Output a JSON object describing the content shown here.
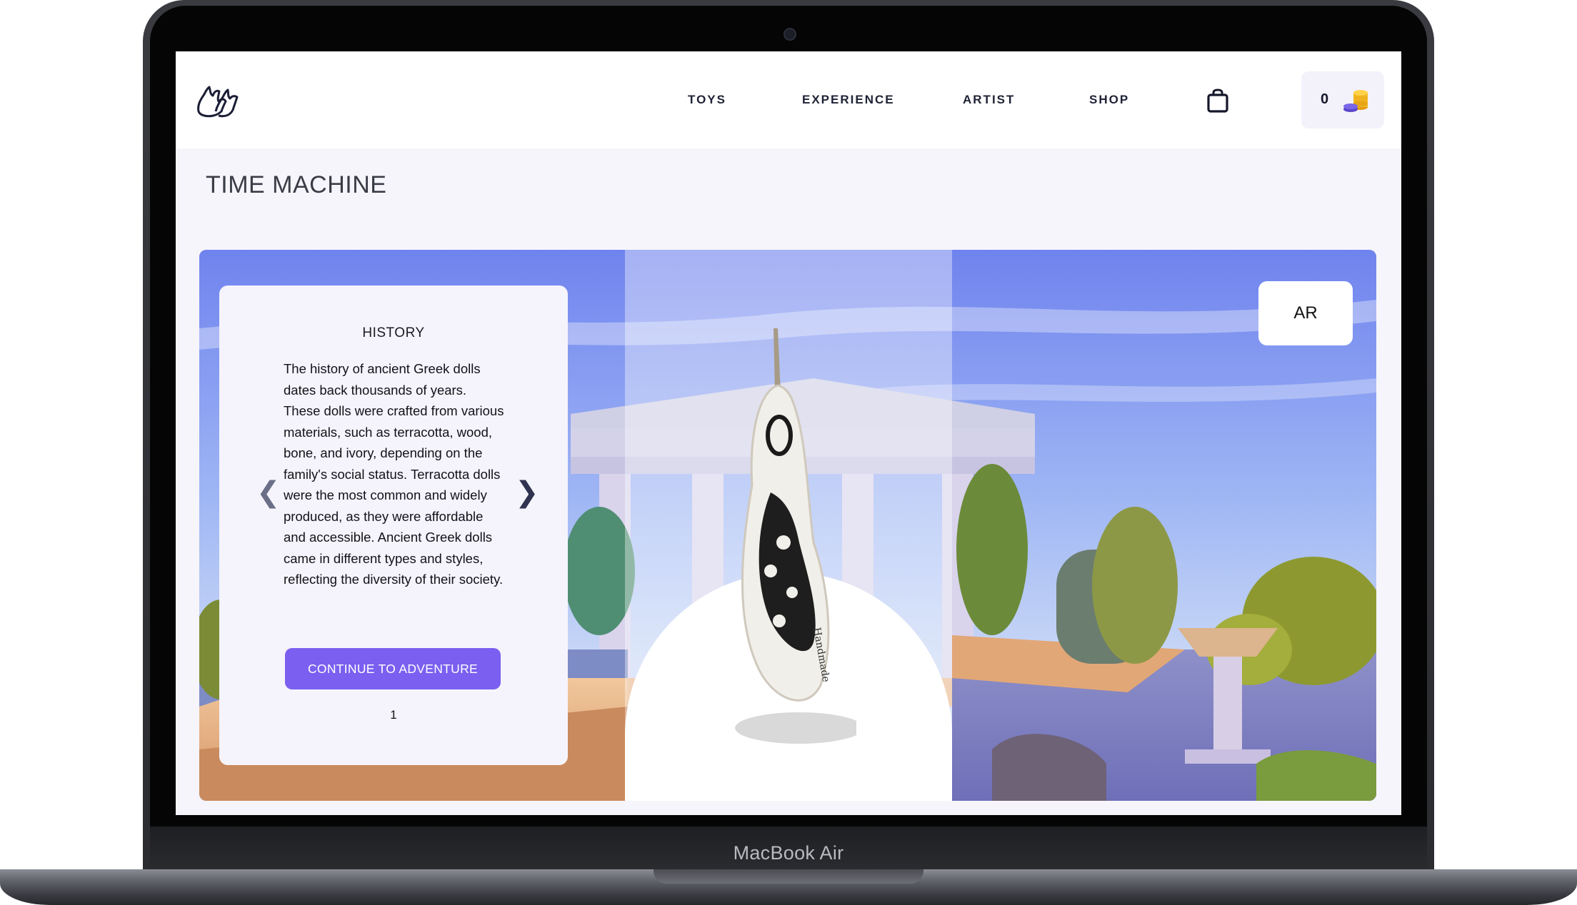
{
  "device": {
    "label": "MacBook Air"
  },
  "nav": {
    "links": [
      "TOYS",
      "EXPERIENCE",
      "ARTIST",
      "SHOP"
    ],
    "coin_count": "0"
  },
  "page": {
    "title": "TIME MACHINE"
  },
  "hero": {
    "ar_label": "AR"
  },
  "card": {
    "title": "HISTORY",
    "body": "The history of ancient Greek dolls dates back thousands of years. These dolls were crafted from various materials, such as terracotta, wood, bone, and ivory, depending on the family's social status. Terracotta dolls were the most common and widely produced, as they were affordable and accessible. Ancient Greek dolls came in different types and styles, reflecting the diversity of their society.",
    "cta_label": "CONTINUE TO ADVENTURE",
    "prev_symbol": "❮",
    "next_symbol": "❯",
    "page_number": "1"
  },
  "icons": {
    "logo": "hands-logo-icon",
    "bag": "shopping-bag-icon",
    "coins": "coins-icon"
  },
  "colors": {
    "accent": "#7a5ff0",
    "sky": "#7d8ff0",
    "card_bg": "#f5f4fc"
  }
}
